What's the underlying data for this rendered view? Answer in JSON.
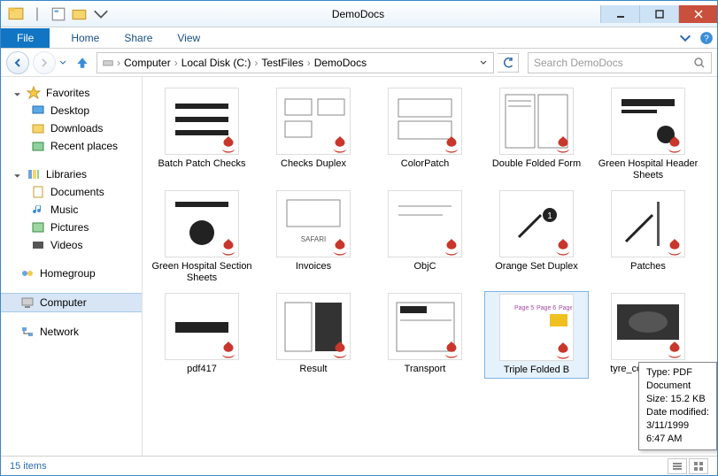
{
  "window": {
    "title": "DemoDocs"
  },
  "ribbon": {
    "file": "File",
    "tabs": [
      "Home",
      "Share",
      "View"
    ]
  },
  "breadcrumb": {
    "parts": [
      "Computer",
      "Local Disk (C:)",
      "TestFiles",
      "DemoDocs"
    ]
  },
  "search": {
    "placeholder": "Search DemoDocs"
  },
  "sidebar": {
    "favorites": {
      "label": "Favorites",
      "items": [
        "Desktop",
        "Downloads",
        "Recent places"
      ]
    },
    "libraries": {
      "label": "Libraries",
      "items": [
        "Documents",
        "Music",
        "Pictures",
        "Videos"
      ]
    },
    "homegroup": {
      "label": "Homegroup"
    },
    "computer": {
      "label": "Computer"
    },
    "network": {
      "label": "Network"
    }
  },
  "files": [
    {
      "name": "Batch Patch Checks"
    },
    {
      "name": "Checks Duplex"
    },
    {
      "name": "ColorPatch"
    },
    {
      "name": "Double Folded Form"
    },
    {
      "name": "Green Hospital Header Sheets"
    },
    {
      "name": "Green Hospital Section Sheets"
    },
    {
      "name": "Invoices"
    },
    {
      "name": "ObjC"
    },
    {
      "name": "Orange Set Duplex"
    },
    {
      "name": "Patches"
    },
    {
      "name": "pdf417"
    },
    {
      "name": "Result"
    },
    {
      "name": "Transport"
    },
    {
      "name": "Triple Folded B",
      "selected": true
    },
    {
      "name": "tyre_collection_M"
    }
  ],
  "tooltip": {
    "type_label": "Type: PDF Document",
    "size_label": "Size: 15.2 KB",
    "modified_label": "Date modified: 3/11/1999 6:47 AM"
  },
  "status": {
    "count": "15 items"
  }
}
